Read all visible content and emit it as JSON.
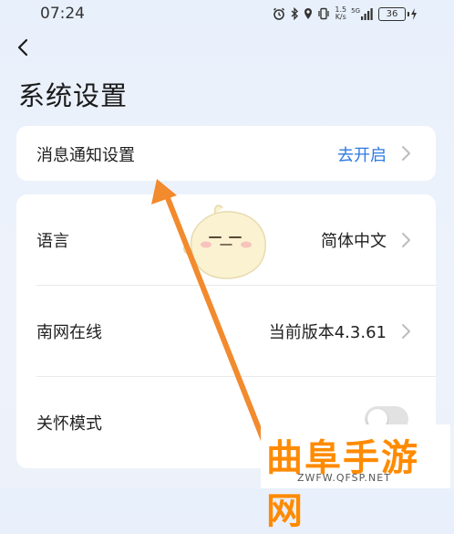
{
  "status_bar": {
    "time": "07:24",
    "net_speed_value": "1.5",
    "net_speed_unit": "K/s",
    "signal_label": "5G",
    "battery": "36"
  },
  "header": {
    "back_icon": "chevron-left-icon",
    "title": "系统设置"
  },
  "notification_card": {
    "label": "消息通知设置",
    "value": "去开启",
    "value_color": "#2f7ae0"
  },
  "settings": {
    "language": {
      "label": "语言",
      "value": "简体中文"
    },
    "online": {
      "label": "南网在线",
      "value": "当前版本4.3.61"
    },
    "care_mode": {
      "label": "关怀模式",
      "enabled": false
    }
  },
  "annotation": {
    "arrow_color": "#f28a2e"
  },
  "watermark": {
    "title": "曲阜手游网",
    "url": "ZWFW.QFSP.NET",
    "color": "#ff8a00"
  }
}
